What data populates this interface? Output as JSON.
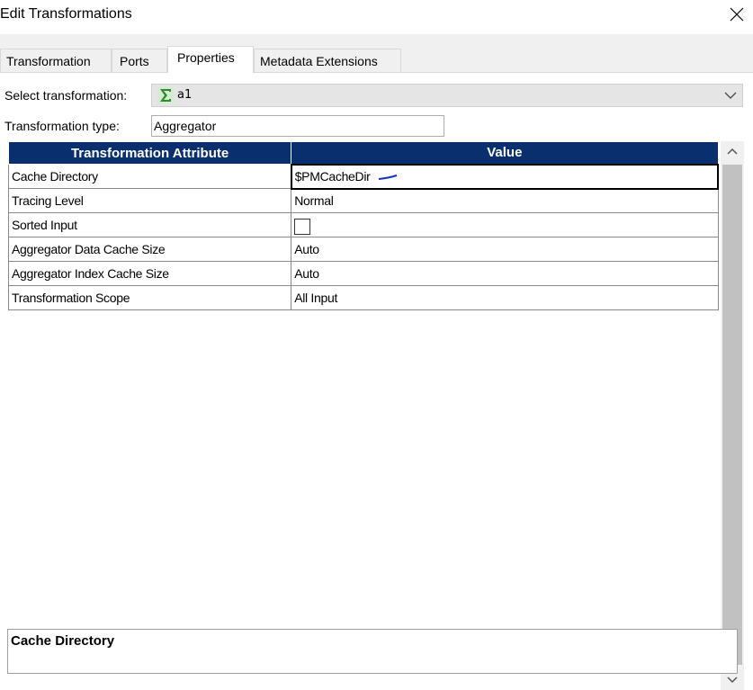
{
  "window": {
    "title": "Edit Transformations",
    "close_icon": "close-icon"
  },
  "tabs": [
    {
      "label": "Transformation",
      "active": false
    },
    {
      "label": "Ports",
      "active": false
    },
    {
      "label": "Properties",
      "active": true
    },
    {
      "label": "Metadata Extensions",
      "active": false
    }
  ],
  "properties": {
    "select_label": "Select transformation:",
    "select_value": "a1",
    "select_icon": "aggregator-sigma-icon",
    "type_label": "Transformation type:",
    "type_value": "Aggregator"
  },
  "grid": {
    "headers": [
      "Transformation Attribute",
      "Value"
    ],
    "header_color": "#0a2f6f",
    "rows": [
      {
        "attribute": "Cache Directory",
        "value": "$PMCacheDir",
        "selected": true
      },
      {
        "attribute": "Tracing Level",
        "value": "Normal"
      },
      {
        "attribute": "Sorted Input",
        "value": "",
        "checkbox": true,
        "checked": false
      },
      {
        "attribute": "Aggregator Data Cache Size",
        "value": "Auto"
      },
      {
        "attribute": "Aggregator Index Cache Size",
        "value": "Auto"
      },
      {
        "attribute": "Transformation Scope",
        "value": "All Input"
      }
    ]
  },
  "description": {
    "title": "Cache Directory"
  }
}
